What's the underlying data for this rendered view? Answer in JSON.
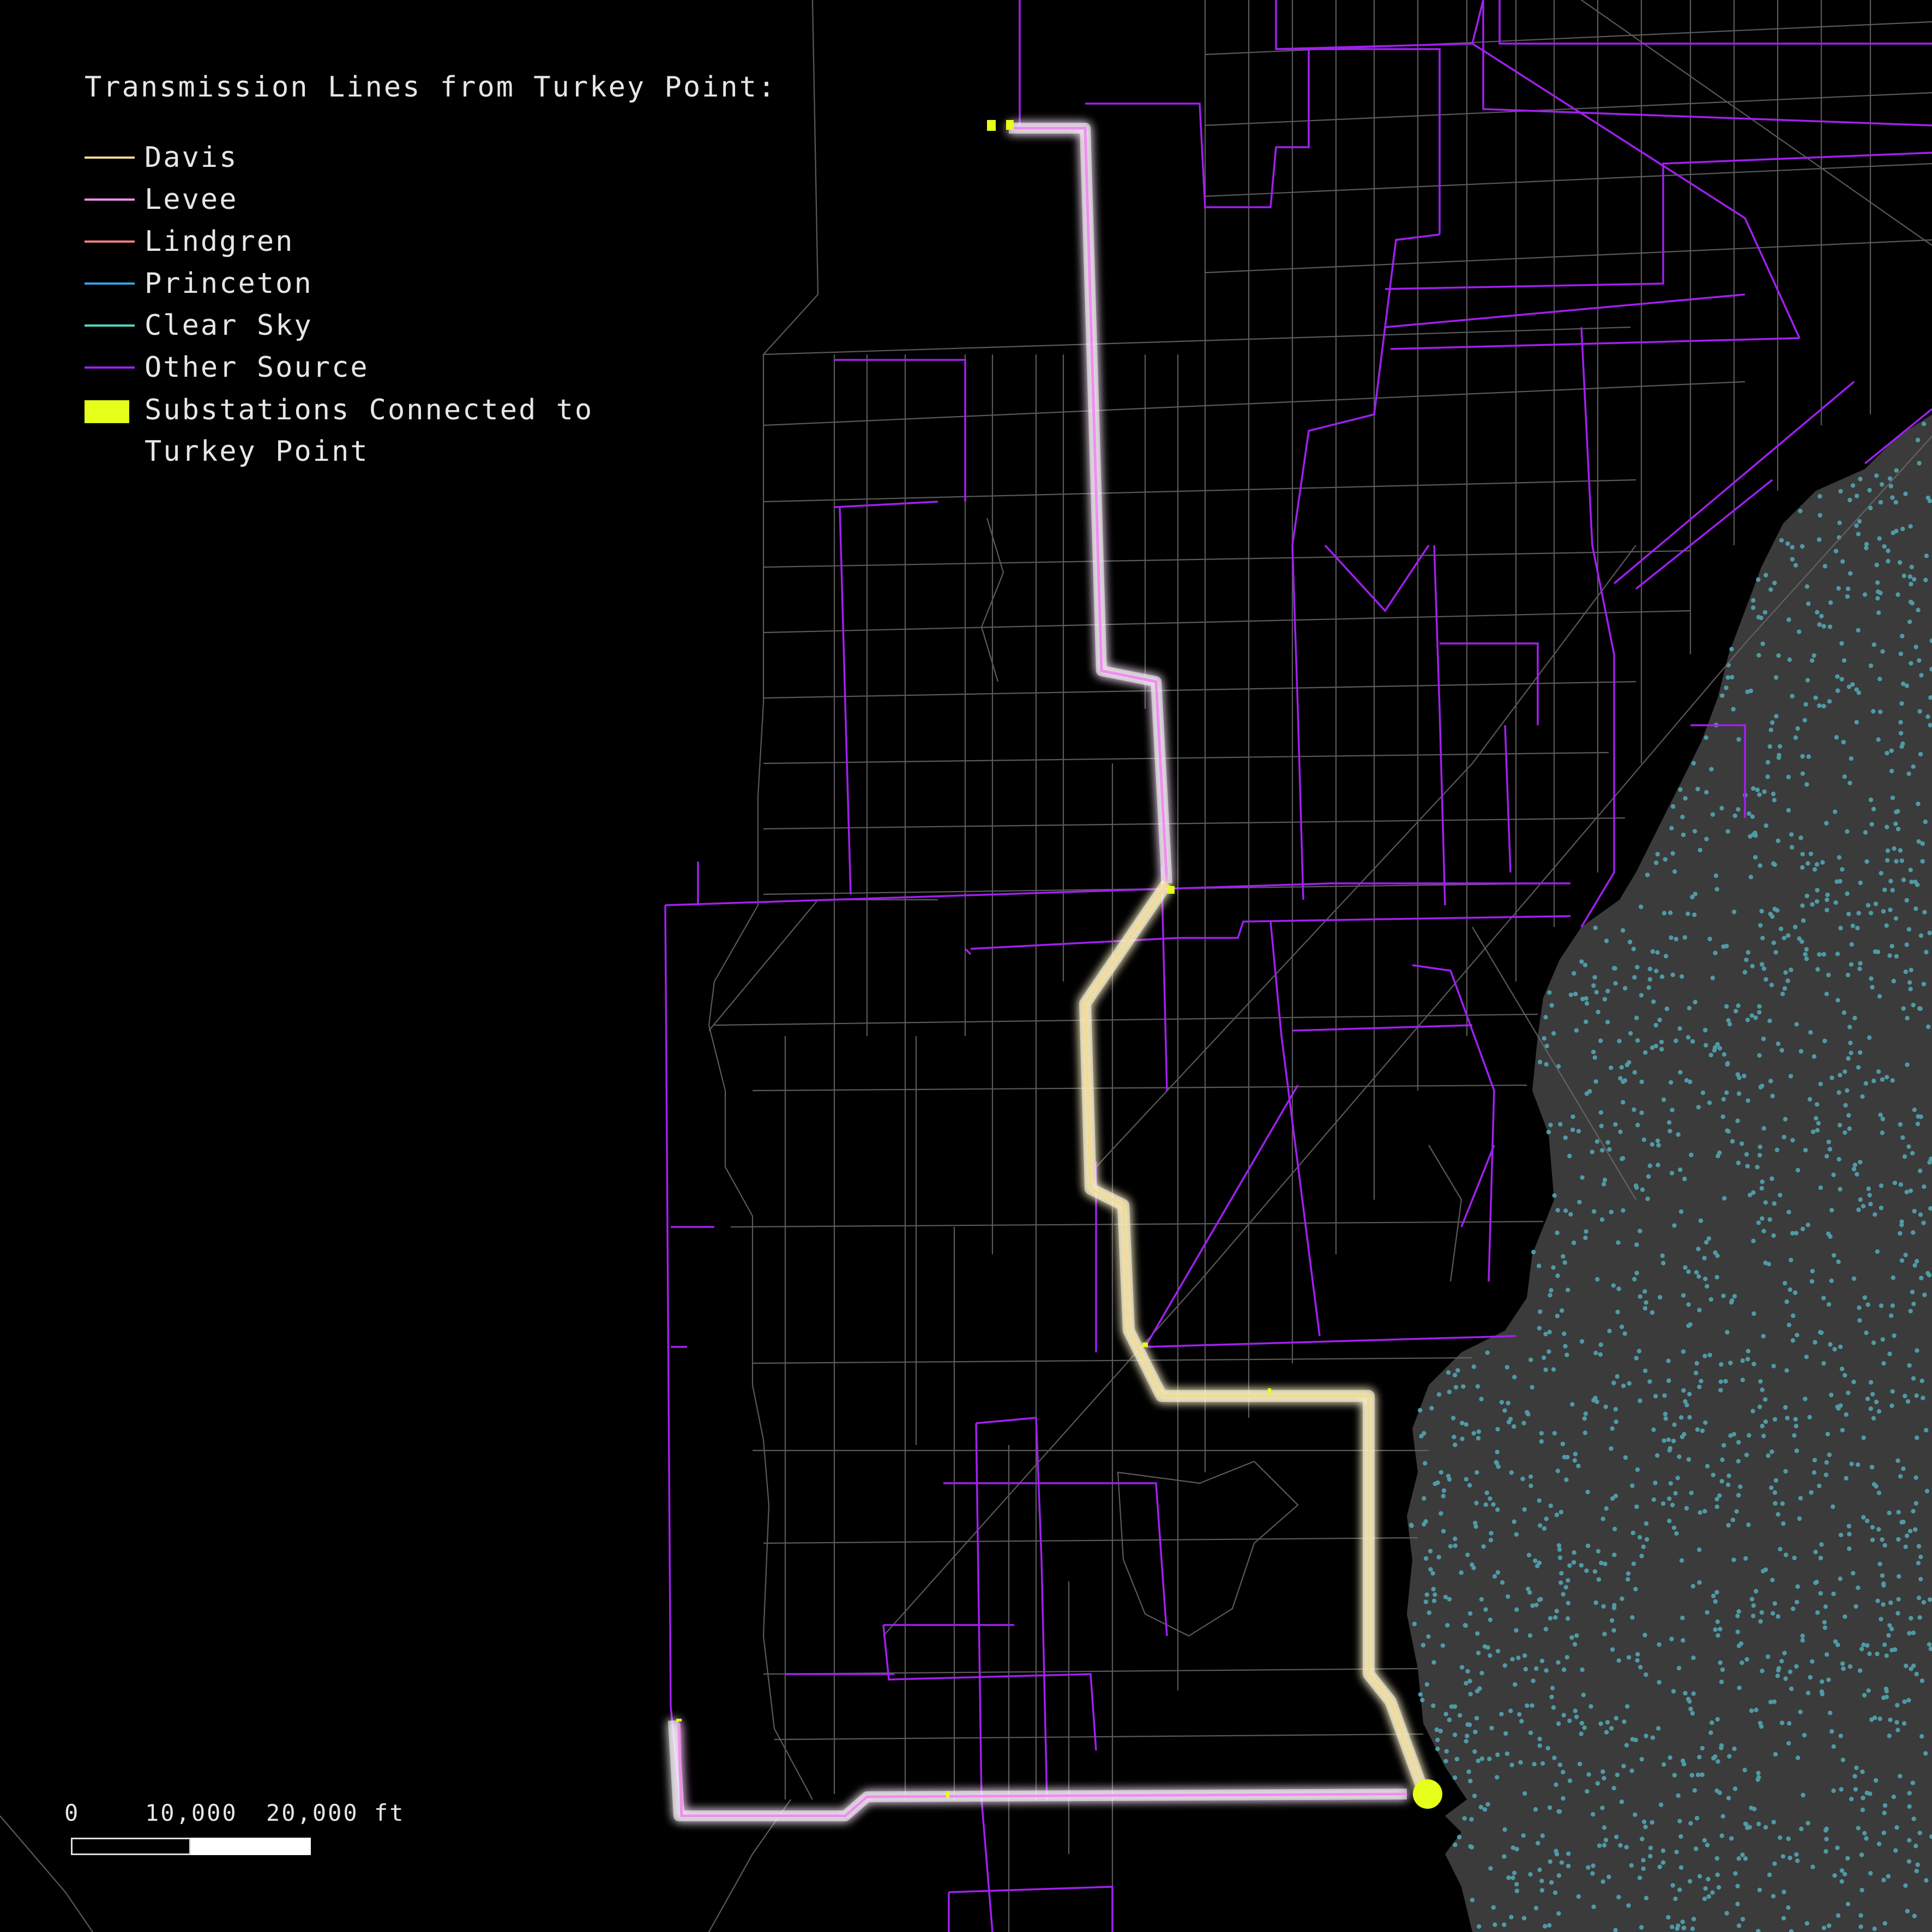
{
  "legend": {
    "title": "Transmission Lines from Turkey Point:",
    "items": [
      {
        "label": "Davis",
        "color": "#f2dc95"
      },
      {
        "label": "Levee",
        "color": "#f08ef0"
      },
      {
        "label": "Lindgren",
        "color": "#f47f7f"
      },
      {
        "label": "Princeton",
        "color": "#3aa0e8"
      },
      {
        "label": "Clear Sky",
        "color": "#4fd8c0"
      },
      {
        "label": "Other Source",
        "color": "#a020f0"
      }
    ],
    "substations": {
      "label_line1": "Substations Connected to",
      "label_line2": "Turkey Point",
      "color": "#e6ff1a"
    }
  },
  "scale": {
    "label_0": "0",
    "label_1": "10,000",
    "label_2": "20,000 ft"
  },
  "colors": {
    "background": "#000000",
    "water": "#3b3b3b",
    "water_dots": "#4f9aa6",
    "roads": "#6f6f6f",
    "other_source": "#a020f0",
    "davis": "#f2dc95",
    "levee": "#f08ef0",
    "substation": "#e6ff1a"
  }
}
